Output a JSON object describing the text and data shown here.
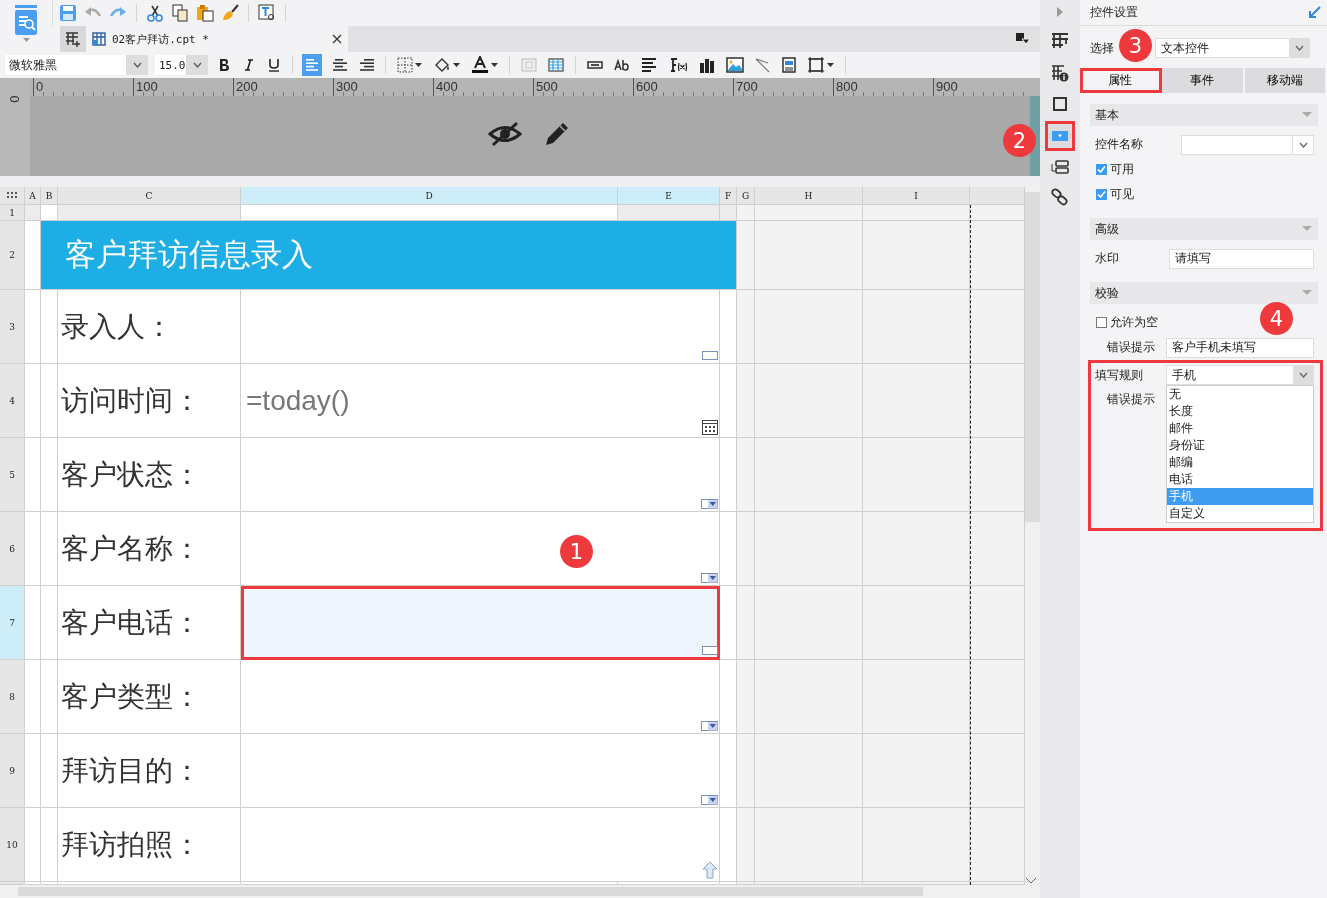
{
  "tab": {
    "title": "02客户拜访.cpt *"
  },
  "format_bar": {
    "font": "微软雅黑",
    "size": "15.0",
    "alignments": [
      {
        "kind": "left",
        "selected": true
      },
      {
        "kind": "center",
        "selected": false
      },
      {
        "kind": "right",
        "selected": false
      }
    ]
  },
  "ruler": {
    "ticks": [
      "0",
      "100",
      "200",
      "300",
      "400",
      "500",
      "600",
      "700",
      "800",
      "900"
    ],
    "side_tick": "0"
  },
  "sheet": {
    "columns": [
      {
        "label": "A",
        "selected": false
      },
      {
        "label": "B",
        "selected": false
      },
      {
        "label": "C",
        "selected": false
      },
      {
        "label": "D",
        "selected": true
      },
      {
        "label": "E",
        "selected": true
      },
      {
        "label": "F",
        "selected": false
      },
      {
        "label": "G",
        "selected": false
      },
      {
        "label": "H",
        "selected": false
      },
      {
        "label": "I",
        "selected": false
      }
    ],
    "rows": [
      {
        "label": "1",
        "selected": false
      },
      {
        "label": "2",
        "selected": false
      },
      {
        "label": "3",
        "selected": false
      },
      {
        "label": "4",
        "selected": false
      },
      {
        "label": "5",
        "selected": false
      },
      {
        "label": "6",
        "selected": false
      },
      {
        "label": "7",
        "selected": true
      },
      {
        "label": "8",
        "selected": false
      },
      {
        "label": "9",
        "selected": false
      },
      {
        "label": "10",
        "selected": false
      }
    ],
    "title": "客户拜访信息录入",
    "fields": [
      {
        "label": "录入人：",
        "kind": "text",
        "selected": false,
        "highlighted": false
      },
      {
        "label": "访问时间：",
        "value": "=today()",
        "kind": "date",
        "selected": false,
        "highlighted": false
      },
      {
        "label": "客户状态：",
        "kind": "combo",
        "selected": false,
        "highlighted": false
      },
      {
        "label": "客户名称：",
        "kind": "combo",
        "selected": false,
        "highlighted": false
      },
      {
        "label": "客户电话：",
        "kind": "text",
        "selected": true,
        "highlighted": true
      },
      {
        "label": "客户类型：",
        "kind": "combo",
        "selected": false,
        "highlighted": false
      },
      {
        "label": "拜访目的：",
        "kind": "combo",
        "selected": false,
        "highlighted": false
      },
      {
        "label": "拜访拍照：",
        "kind": "upload",
        "selected": false,
        "highlighted": false
      }
    ]
  },
  "side_icons": [
    {
      "kind": "collapse",
      "selected": false,
      "highlighted": false
    },
    {
      "kind": "cell",
      "selected": false,
      "highlighted": false
    },
    {
      "kind": "info",
      "selected": false,
      "highlighted": false
    },
    {
      "kind": "frame",
      "selected": false,
      "highlighted": false
    },
    {
      "kind": "widget",
      "selected": true,
      "highlighted": true
    },
    {
      "kind": "list",
      "selected": false,
      "highlighted": false
    },
    {
      "kind": "link",
      "selected": false,
      "highlighted": false
    }
  ],
  "panel": {
    "title": "控件设置",
    "select": {
      "label": "选择",
      "value": "文本控件"
    },
    "tabs": [
      {
        "label": "属性",
        "selected": true,
        "highlighted": true
      },
      {
        "label": "事件",
        "selected": false,
        "highlighted": false
      },
      {
        "label": "移动端",
        "selected": false,
        "highlighted": false
      }
    ],
    "groups": [
      {
        "title": "基本",
        "rows": [
          {
            "kind": "combo",
            "label": "控件名称"
          },
          {
            "kind": "checkbox",
            "label": "可用",
            "checked": true
          },
          {
            "kind": "checkbox",
            "label": "可见",
            "checked": true
          }
        ]
      },
      {
        "title": "高级",
        "rows": [
          {
            "kind": "field",
            "label": "水印",
            "value": "请填写"
          }
        ]
      },
      {
        "title": "校验",
        "rows": [
          {
            "kind": "checkbox",
            "label": "允许为空",
            "checked": false
          },
          {
            "kind": "subfield",
            "label": "错误提示",
            "value": "客户手机未填写"
          },
          {
            "kind": "rule",
            "label": "填写规则",
            "value": "手机",
            "sub_label": "错误提示",
            "highlighted": true,
            "options": [
              {
                "label": "无",
                "selected": false
              },
              {
                "label": "长度",
                "selected": false
              },
              {
                "label": "邮件",
                "selected": false
              },
              {
                "label": "身份证",
                "selected": false
              },
              {
                "label": "邮编",
                "selected": false
              },
              {
                "label": "电话",
                "selected": false
              },
              {
                "label": "手机",
                "selected": true
              },
              {
                "label": "自定义",
                "selected": false
              }
            ]
          }
        ]
      }
    ]
  },
  "annotations": [
    {
      "number": "1"
    },
    {
      "number": "2"
    },
    {
      "number": "3"
    },
    {
      "number": "4"
    }
  ]
}
